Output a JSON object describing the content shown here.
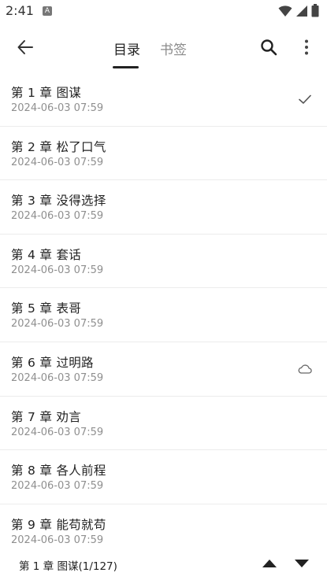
{
  "status_bar": {
    "time": "2:41",
    "notification_glyph": "A",
    "icons": [
      "wifi-icon",
      "signal-icon",
      "battery-icon"
    ]
  },
  "toolbar": {
    "back_icon": "arrow-left-icon",
    "tabs": [
      {
        "label": "目录",
        "selected": true
      },
      {
        "label": "书签",
        "selected": false
      }
    ],
    "search_icon": "search-icon",
    "more_icon": "more-vertical-icon"
  },
  "chapters": [
    {
      "title": "第 1 章 图谋",
      "date": "2024-06-03 07:59",
      "mark": "check-icon"
    },
    {
      "title": "第 2 章 松了口气",
      "date": "2024-06-03 07:59",
      "mark": ""
    },
    {
      "title": "第 3 章 没得选择",
      "date": "2024-06-03 07:59",
      "mark": ""
    },
    {
      "title": "第 4 章 套话",
      "date": "2024-06-03 07:59",
      "mark": ""
    },
    {
      "title": "第 5 章 表哥",
      "date": "2024-06-03 07:59",
      "mark": ""
    },
    {
      "title": "第 6 章 过明路",
      "date": "2024-06-03 07:59",
      "mark": "cloud-icon"
    },
    {
      "title": "第 7 章 劝言",
      "date": "2024-06-03 07:59",
      "mark": ""
    },
    {
      "title": "第 8 章 各人前程",
      "date": "2024-06-03 07:59",
      "mark": ""
    },
    {
      "title": "第 9 章 能苟就苟",
      "date": "2024-06-03 07:59",
      "mark": ""
    }
  ],
  "bottom_bar": {
    "current": "第 1 章 图谋(1/127)",
    "up_icon": "triangle-up-icon",
    "down_icon": "triangle-down-icon"
  }
}
